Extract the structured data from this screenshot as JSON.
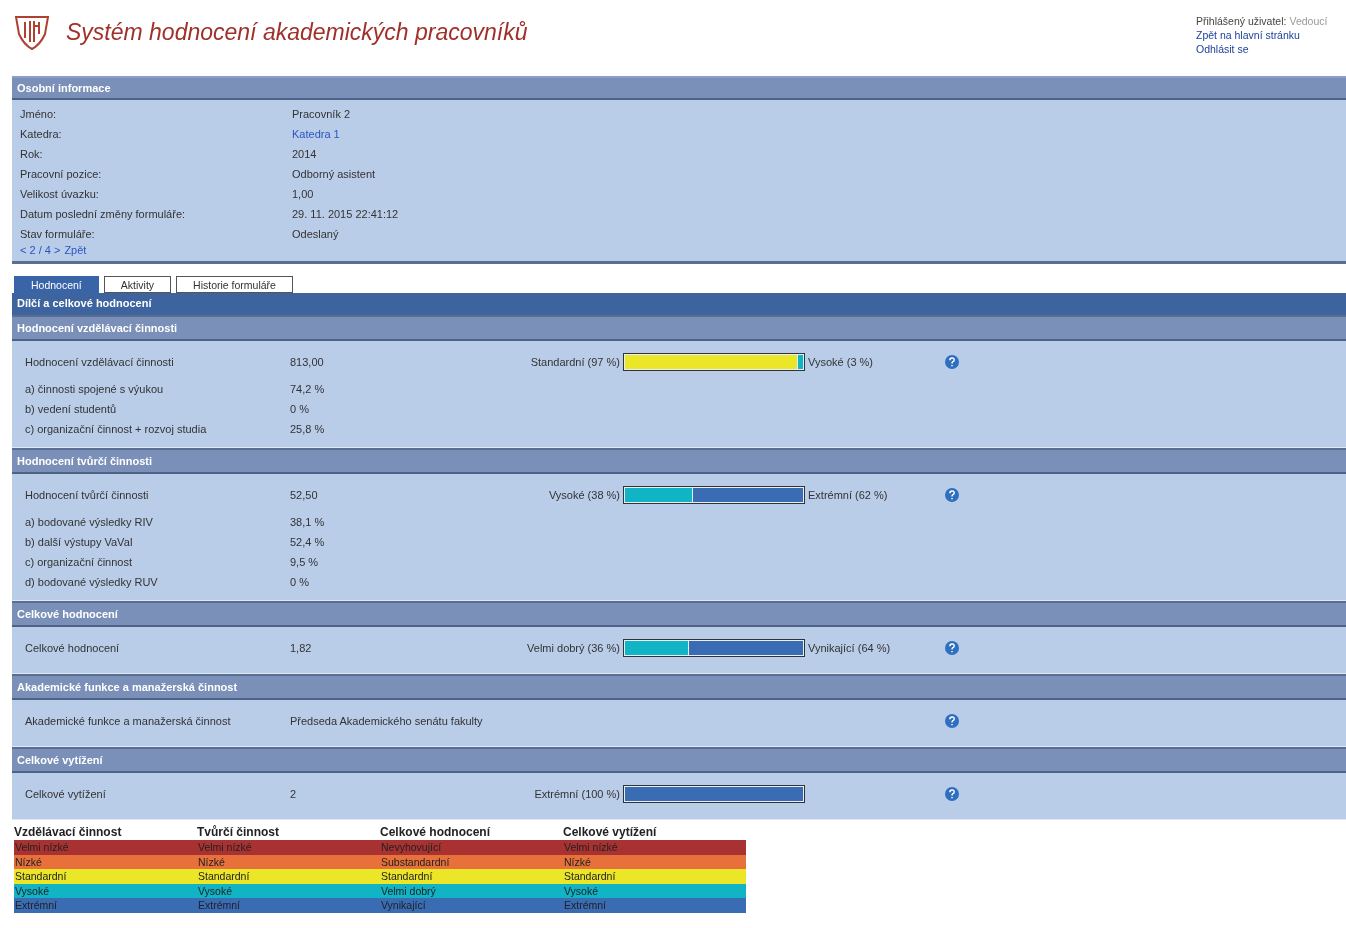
{
  "header": {
    "title": "Systém hodnocení akademických pracovníků",
    "user_label": "Přihlášený uživatel:",
    "user_role": "Vedoucí",
    "links": [
      "Zpět na hlavní stránku",
      "Odhlásit se"
    ]
  },
  "personal": {
    "title": "Osobní informace",
    "fields": [
      {
        "label": "Jméno:",
        "value": "Pracovník 2",
        "kind": "text"
      },
      {
        "label": "Katedra:",
        "value": "Katedra 1",
        "kind": "link"
      },
      {
        "label": "Rok:",
        "value": "2014",
        "kind": "text"
      },
      {
        "label": "Pracovní pozice:",
        "value": "Odborný asistent",
        "kind": "text"
      },
      {
        "label": "Velikost úvazku:",
        "value": "1,00",
        "kind": "text"
      },
      {
        "label": "Datum poslední změny formuláře:",
        "value": "29. 11. 2015 22:41:12",
        "kind": "text"
      },
      {
        "label": "Stav formuláře:",
        "value": "Odeslaný",
        "kind": "text"
      }
    ],
    "pager": "< 2 / 4 >",
    "back": "Zpět"
  },
  "tabs": [
    {
      "label": "Hodnocení",
      "selected": true
    },
    {
      "label": "Aktivity",
      "selected": false
    },
    {
      "label": "Historie formuláře",
      "selected": false
    }
  ],
  "evaluation": {
    "title": "Dílčí a celkové hodnocení",
    "sections": [
      {
        "title": "Hodnocení vzdělávací činnosti",
        "main": {
          "label": "Hodnocení vzdělávací činnosti",
          "value": "813,00",
          "bar": {
            "left_label": "Standardní (97 %)",
            "right_label": "Vysoké (3 %)",
            "segments": [
              {
                "level": 0.97,
                "color": "#ece628"
              },
              {
                "level": 0.03,
                "color": "#10b4c4"
              }
            ]
          }
        },
        "items": [
          {
            "label": "a) činnosti spojené s výukou",
            "value": "74,2 %"
          },
          {
            "label": "b) vedení studentů",
            "value": "0 %"
          },
          {
            "label": "c) organizační činnost + rozvoj studia",
            "value": "25,8 %"
          }
        ]
      },
      {
        "title": "Hodnocení tvůrčí činnosti",
        "main": {
          "label": "Hodnocení tvůrčí činnosti",
          "value": "52,50",
          "bar": {
            "left_label": "Vysoké (38 %)",
            "right_label": "Extrémní (62 %)",
            "segments": [
              {
                "level": 0.38,
                "color": "#10b4c4"
              },
              {
                "level": 0.62,
                "color": "#3a6cb4"
              }
            ]
          }
        },
        "items": [
          {
            "label": "a) bodované výsledky RIV",
            "value": "38,1 %"
          },
          {
            "label": "b) další výstupy VaVaI",
            "value": "52,4 %"
          },
          {
            "label": "c) organizační činnost",
            "value": "9,5 %"
          },
          {
            "label": "d) bodované výsledky RUV",
            "value": "0 %"
          }
        ]
      },
      {
        "title": "Celkové hodnocení",
        "main": {
          "label": "Celkové hodnocení",
          "value": "1,82",
          "bar": {
            "left_label": "Velmi dobrý (36 %)",
            "right_label": "Vynikající (64 %)",
            "segments": [
              {
                "level": 0.36,
                "color": "#10b4c4"
              },
              {
                "level": 0.64,
                "color": "#3a6cb4"
              }
            ]
          }
        }
      },
      {
        "title": "Akademické funkce a manažerská činnost",
        "main": {
          "label": "Akademické funkce a manažerská činnost",
          "value": "Předseda Akademického senátu fakulty"
        }
      },
      {
        "title": "Celkové vytížení",
        "main": {
          "label": "Celkové vytížení",
          "value": "2",
          "bar": {
            "left_label": "Extrémní (100 %)",
            "segments": [
              {
                "level": 1,
                "color": "#3a6cb4"
              }
            ]
          }
        }
      }
    ]
  },
  "legend": [
    {
      "title": "Vzdělávací činnost",
      "items": [
        {
          "label": "Velmi nízké",
          "color": "#a83232"
        },
        {
          "label": "Nízké",
          "color": "#e8703a"
        },
        {
          "label": "Standardní",
          "color": "#ece628"
        },
        {
          "label": "Vysoké",
          "color": "#10b4c4"
        },
        {
          "label": "Extrémní",
          "color": "#3a6cb4"
        }
      ]
    },
    {
      "title": "Tvůrčí činnost",
      "items": [
        {
          "label": "Velmi nízké",
          "color": "#a83232"
        },
        {
          "label": "Nízké",
          "color": "#e8703a"
        },
        {
          "label": "Standardní",
          "color": "#ece628"
        },
        {
          "label": "Vysoké",
          "color": "#10b4c4"
        },
        {
          "label": "Extrémní",
          "color": "#3a6cb4"
        }
      ]
    },
    {
      "title": "Celkové hodnocení",
      "items": [
        {
          "label": "Nevyhovující",
          "color": "#a83232"
        },
        {
          "label": "Substandardní",
          "color": "#e8703a"
        },
        {
          "label": "Standardní",
          "color": "#ece628"
        },
        {
          "label": "Velmi dobrý",
          "color": "#10b4c4"
        },
        {
          "label": "Vynikající",
          "color": "#3a6cb4"
        }
      ]
    },
    {
      "title": "Celkové vytížení",
      "items": [
        {
          "label": "Velmi nízké",
          "color": "#a83232"
        },
        {
          "label": "Nízké",
          "color": "#e8703a"
        },
        {
          "label": "Standardní",
          "color": "#ece628"
        },
        {
          "label": "Vysoké",
          "color": "#10b4c4"
        },
        {
          "label": "Extrémní",
          "color": "#3a6cb4"
        }
      ]
    }
  ]
}
